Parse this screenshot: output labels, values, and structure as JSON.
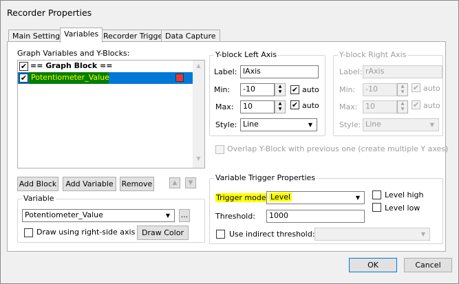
{
  "window": {
    "title": "Recorder Properties"
  },
  "tabs": [
    "Main Settings",
    "Variables",
    "Recorder Trigger",
    "Data Capture"
  ],
  "graph_list": {
    "label": "Graph Variables and Y-Blocks:",
    "items": [
      {
        "label": "== Graph Block ==",
        "checked": true
      },
      {
        "label": "Potentiometer_Value",
        "checked": true,
        "color": "#e53935"
      }
    ]
  },
  "list_buttons": {
    "add_block": "Add Block",
    "add_variable": "Add Variable",
    "remove": "Remove"
  },
  "variable": {
    "legend": "Variable",
    "value": "Potentiometer_Value",
    "browse": "...",
    "right_axis_label": "Draw using right-side axis",
    "draw_color": "Draw Color"
  },
  "left_axis": {
    "legend": "Y-block Left Axis",
    "label_lbl": "Label:",
    "label": "lAxis",
    "min_lbl": "Min:",
    "min": "-10",
    "max_lbl": "Max:",
    "max": "10",
    "auto": "auto",
    "style_lbl": "Style:",
    "style": "Line"
  },
  "right_axis": {
    "legend": "Y-block Right Axis",
    "label_lbl": "Label:",
    "label": "rAxis",
    "min_lbl": "Min:",
    "min": "-10",
    "max_lbl": "Max:",
    "max": "10",
    "auto": "auto",
    "style_lbl": "Style:",
    "style": "Line"
  },
  "overlap": "Overlap Y-Block with previous one (create multiple Y axes)",
  "trigger": {
    "legend": "Variable Trigger Properties",
    "mode_lbl": "Trigger mode:",
    "mode": "Level",
    "threshold_lbl": "Threshold:",
    "threshold": "1000",
    "level_high": "Level high",
    "level_low": "Level low",
    "indirect": "Use indirect threshold:"
  },
  "footer": {
    "ok": "OK",
    "cancel": "Cancel"
  }
}
